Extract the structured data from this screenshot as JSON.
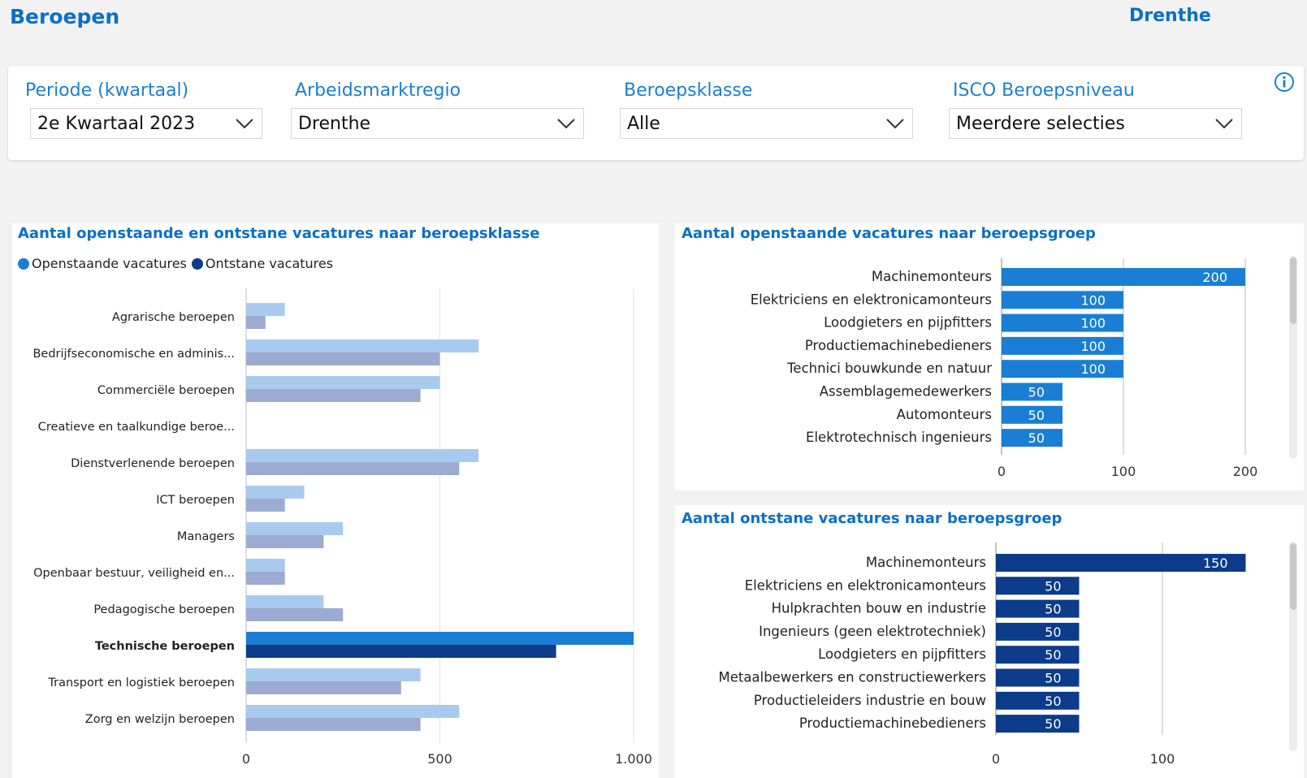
{
  "header": {
    "title": "Beroepen",
    "region": "Drenthe"
  },
  "filters": [
    {
      "label": "Periode (kwartaal)",
      "value": "2e Kwartaal 2023"
    },
    {
      "label": "Arbeidsmarktregio",
      "value": "Drenthe"
    },
    {
      "label": "Beroepsklasse",
      "value": "Alle"
    },
    {
      "label": "ISCO Beroepsniveau",
      "value": "Meerdere selecties"
    }
  ],
  "icons": {
    "info": "info-icon",
    "dropdown": "chevron-down-icon"
  },
  "colors": {
    "brand": "#0b6fc7",
    "open": "#1a7fd4",
    "onstane": "#0c3b8a",
    "open_faded": "#a9caef",
    "onstane_faded": "#9cabd2"
  },
  "chart_data": [
    {
      "type": "bar",
      "orientation": "horizontal",
      "title": "Aantal openstaande en ontstane vacatures naar beroepsklasse",
      "categories": [
        "Agrarische beroepen",
        "Bedrijfseconomische en adminis...",
        "Commerciële beroepen",
        "Creatieve en taalkundige beroe...",
        "Dienstverlenende beroepen",
        "ICT beroepen",
        "Managers",
        "Openbaar bestuur, veiligheid en...",
        "Pedagogische beroepen",
        "Technische beroepen",
        "Transport en logistiek beroepen",
        "Zorg en welzijn beroepen"
      ],
      "series": [
        {
          "name": "Openstaande vacatures",
          "values": [
            100,
            600,
            500,
            0,
            600,
            150,
            250,
            100,
            200,
            1000,
            450,
            550
          ]
        },
        {
          "name": "Ontstane vacatures",
          "values": [
            50,
            500,
            450,
            0,
            550,
            100,
            200,
            100,
            250,
            800,
            400,
            450
          ]
        }
      ],
      "highlighted_category": "Technische beroepen",
      "xlim": [
        0,
        1000
      ],
      "xticks": [
        "0",
        "500",
        "1.000"
      ],
      "grid": true,
      "legend": "top-left"
    },
    {
      "type": "bar",
      "orientation": "horizontal",
      "title": "Aantal openstaande vacatures naar beroepsgroep",
      "categories": [
        "Machinemonteurs",
        "Elektriciens en elektronicamonteurs",
        "Loodgieters en pijpfitters",
        "Productiemachinebedieners",
        "Technici bouwkunde en natuur",
        "Assemblagemedewerkers",
        "Automonteurs",
        "Elektrotechnisch ingenieurs"
      ],
      "values": [
        200,
        100,
        100,
        100,
        100,
        50,
        50,
        50
      ],
      "xlim": [
        0,
        200
      ],
      "xticks": [
        "0",
        "100",
        "200"
      ],
      "grid": true
    },
    {
      "type": "bar",
      "orientation": "horizontal",
      "title": "Aantal ontstane vacatures naar beroepsgroep",
      "categories": [
        "Machinemonteurs",
        "Elektriciens en elektronicamonteurs",
        "Hulpkrachten bouw en industrie",
        "Ingenieurs (geen elektrotechniek)",
        "Loodgieters en pijpfitters",
        "Metaalbewerkers en constructiewerkers",
        "Productieleiders industrie en bouw",
        "Productiemachinebedieners"
      ],
      "values": [
        150,
        50,
        50,
        50,
        50,
        50,
        50,
        50
      ],
      "xlim": [
        0,
        150
      ],
      "xticks": [
        "0",
        "100"
      ],
      "grid": true
    }
  ]
}
